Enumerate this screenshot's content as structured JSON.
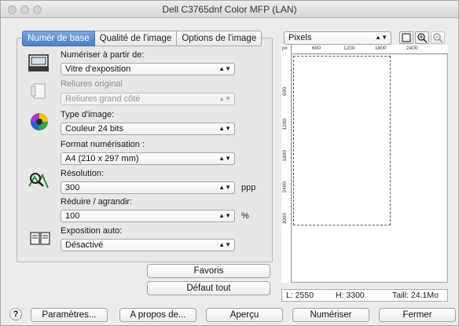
{
  "window": {
    "title": "Dell C3765dnf Color MFP (LAN)"
  },
  "tabs": [
    "Numér de base",
    "Qualité de l'image",
    "Options de l'image"
  ],
  "scan_from": {
    "label": "Numériser à partir de:",
    "value": "Vitre d'exposition"
  },
  "binding": {
    "label": "Reliures original",
    "value": "Reliures grand côté"
  },
  "image_type": {
    "label": "Type d'image:",
    "value": "Couleur 24 bits"
  },
  "scan_format": {
    "label": "Format numérisation :",
    "value": "A4 (210 x 297 mm)"
  },
  "resolution": {
    "label": "Résolution:",
    "value": "300",
    "unit": "ppp"
  },
  "reduce_enlarge": {
    "label": "Réduire / agrandir:",
    "value": "100",
    "unit": "%"
  },
  "auto_exposure": {
    "label": "Exposition auto:",
    "value": "Désactivé"
  },
  "buttons": {
    "favorites": "Favoris",
    "default_all": "Défaut tout"
  },
  "preview": {
    "unit_select": "Pixels",
    "ruler_unit": "px",
    "top_ticks": [
      "600",
      "1200",
      "1800",
      "2400"
    ],
    "left_ticks": [
      "600",
      "1200",
      "1800",
      "2400",
      "3000"
    ]
  },
  "status": {
    "width": "L:  2550",
    "height": "H:  3300",
    "size": "Taill:  24.1Mo"
  },
  "footer": {
    "help": "?",
    "settings": "Paramètres...",
    "about": "A propos de...",
    "preview": "Aperçu",
    "scan": "Numériser",
    "close": "Fermer"
  }
}
